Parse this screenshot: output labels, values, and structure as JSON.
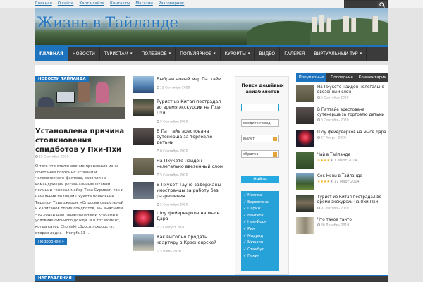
{
  "top_links": [
    "Главная",
    "О сайте",
    "Карта сайта",
    "Контакты",
    "Магазин",
    "Разговорник"
  ],
  "site_title": "Жизнь в Тайланде",
  "nav": [
    {
      "label": "ГЛАВНАЯ",
      "dropdown": false,
      "active": true
    },
    {
      "label": "НОВОСТИ",
      "dropdown": false,
      "active": false
    },
    {
      "label": "ТУРИСТАМ",
      "dropdown": true,
      "active": false
    },
    {
      "label": "ПОЛЕЗНОЕ",
      "dropdown": true,
      "active": false
    },
    {
      "label": "ПОПУЛЯРНОЕ",
      "dropdown": true,
      "active": false
    },
    {
      "label": "КУРОРТЫ",
      "dropdown": true,
      "active": false
    },
    {
      "label": "ВИДЕО",
      "dropdown": false,
      "active": false
    },
    {
      "label": "ГАЛЕРЕЯ",
      "dropdown": false,
      "active": false
    },
    {
      "label": "ВИРТУАЛЬНЫЙ ТУР",
      "dropdown": true,
      "active": false
    }
  ],
  "featured": {
    "tag": "НОВОСТИ ТАЙЛАНДА",
    "title": "Установлена причина столкновения спидботов у Пхи-Пхи",
    "date": "15 Сентябрь 2020",
    "body": "О том, что столкновение произошло из-за сочетания погодных условий и человеческого фактора, заявили на командующий региональным штабом полиции генерал-майор Теса Сириват, так и начальник полиции Пхукета полковник Тирапон Тхипджарон. «Опросив свидетелей и капитанов обоих спидботов, мы выяснили что лодки шли параллельными курсами в условиях сильного дождя. И в тот момент, когда катер Chonlakj сбросил скорость, вторая лодка – Hongfa 33 ...",
    "more": "Подробнее »"
  },
  "news_list": [
    {
      "title": "Выбран новый мэр Паттайи",
      "date": "12 Сентябрь 2020"
    },
    {
      "title": "Турист из Китая пострадал во время экскурсии на Пхи-Пхи",
      "date": "9 Сентябрь 2020"
    },
    {
      "title": "В Паттайе арестована сутенерша за торговлю детьми",
      "date": "6 Сентябрь 2020"
    },
    {
      "title": "На Пхукете найден нелегально ввезенный слон",
      "date": "5 Сентябрь 2020"
    },
    {
      "title": "В Пхукет-Тауне задержаны иностранцы за работу без разрешения",
      "date": "2 Сентябрь 2020"
    },
    {
      "title": "Шоу фейерверков на мысе Дара",
      "date": "27 Август 2020"
    },
    {
      "title": "Как выгодно продать квартиру в Красноярске?",
      "date": "5 Июль 2020"
    }
  ],
  "flight_widget": {
    "title": "Поиск дешёвых авиабилетов",
    "from_placeholder": "",
    "to_placeholder": "введите город",
    "depart_placeholder": "вылет",
    "return_placeholder": "обратно",
    "button": "Найти",
    "cities": [
      "Москва",
      "Барселона",
      "Париж",
      "Бангкок",
      "Нью-Йорк",
      "Рим",
      "Мадрид",
      "Мюнхен",
      "Стамбул",
      "Пекин"
    ]
  },
  "tabs": [
    "Популярные",
    "Последние",
    "Комментарии"
  ],
  "popular": [
    {
      "title": "На Пхукете найден нелегально ввезенный слон",
      "date": "5 Сентябрь 2020",
      "rating": null
    },
    {
      "title": "В Паттайе арестована сутенерша за торговлю детьми",
      "date": "6 Сентябрь 2020",
      "rating": null
    },
    {
      "title": "Шоу фейерверков на мысе Дара",
      "date": "27 Август 2020",
      "rating": null
    },
    {
      "title": "Чай в Тайланде",
      "date": "1 Март 2014",
      "rating": 4
    },
    {
      "title": "Сок Нони в Тайланде",
      "date": "11 Март 2014",
      "rating": 4
    },
    {
      "title": "Турист из Китая пострадал во время экскурсии на Пхи-Пхи",
      "date": "9 Сентябрь 2020",
      "rating": null
    },
    {
      "title": "Что такое танто",
      "date": "30 Декабрь 2019",
      "rating": null
    }
  ],
  "bottom_tag": "НАПРАВЛЕНИЯ",
  "colors": {
    "accent": "#1e73be",
    "nav_bg": "#3b3b3b",
    "widget_blue": "#27a2d8"
  }
}
